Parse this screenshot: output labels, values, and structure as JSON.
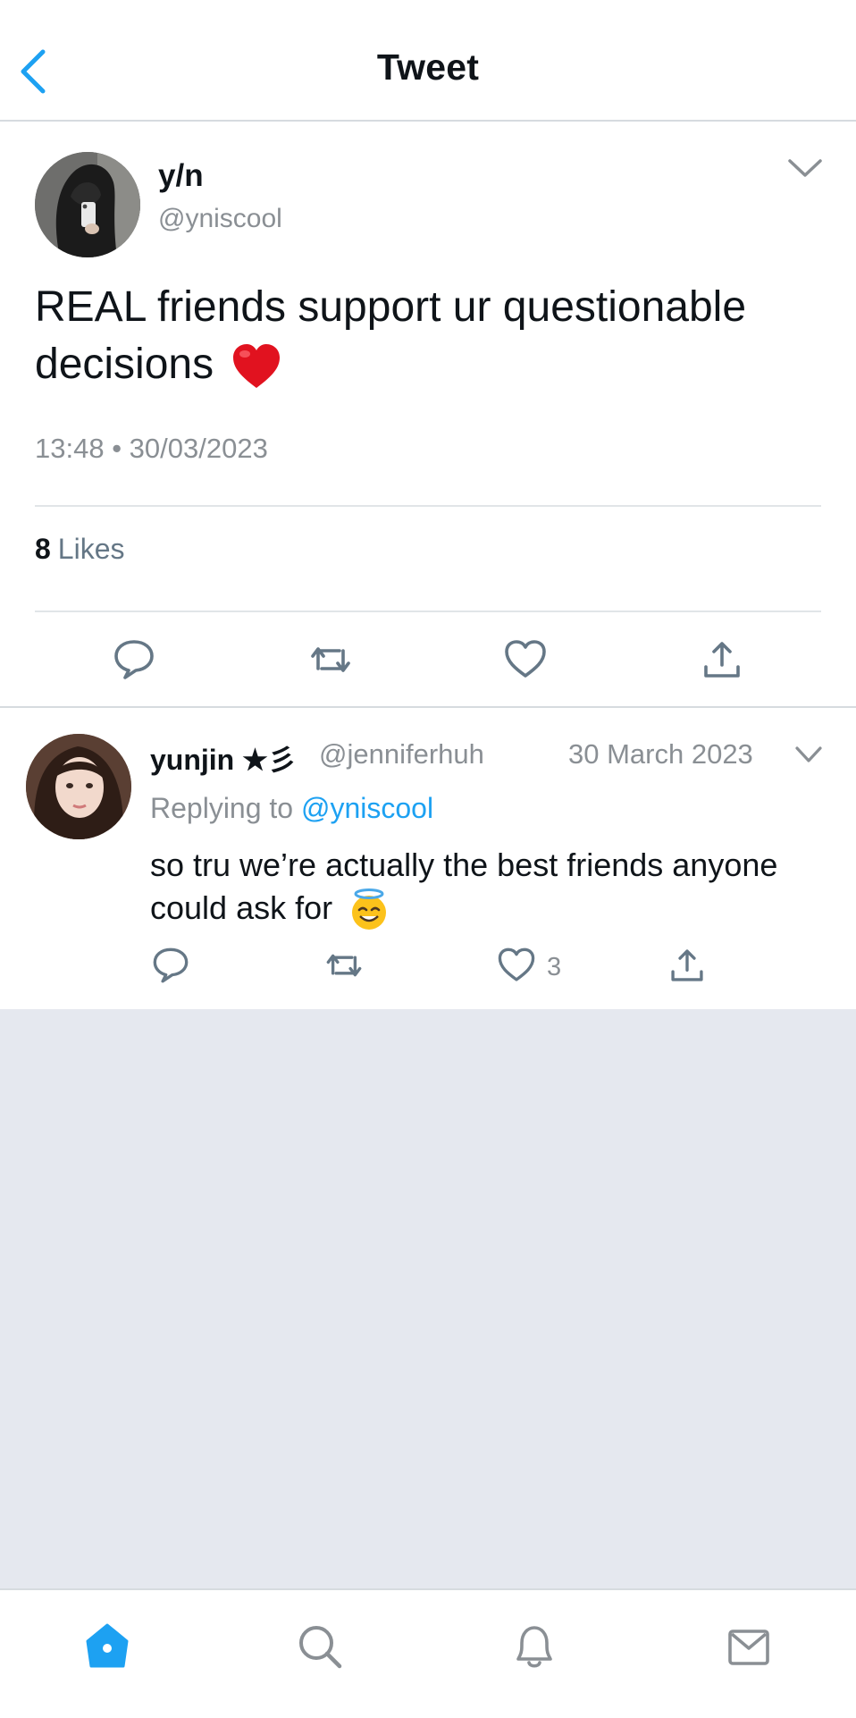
{
  "header": {
    "title": "Tweet"
  },
  "tweet": {
    "author_name": "y/n",
    "author_handle": "@yniscool",
    "text": "REAL friends support ur questionable decisions",
    "emoji": "red-heart",
    "timestamp": "13:48 • 30/03/2023",
    "likes_count": "8",
    "likes_label": "Likes"
  },
  "reply": {
    "author_name": "yunjin ★彡",
    "author_handle": "@jenniferhuh",
    "date": "30 March 2023",
    "replying_prefix": "Replying to",
    "replying_to": "@yniscool",
    "text": "so tru we’re actually the best friends anyone could ask for",
    "emoji": "smiling-face-with-halo",
    "like_count": "3"
  },
  "colors": {
    "accent": "#1da1f2",
    "secondary_text": "#8a8f94",
    "empty_area": "#e5e8ef",
    "icon_gray": "#657786"
  },
  "icons": {
    "header": [
      "back-chevron-icon"
    ],
    "actions": [
      "reply-icon",
      "retweet-icon",
      "like-icon",
      "share-icon"
    ],
    "tabs": [
      "home-icon",
      "search-icon",
      "notifications-icon",
      "messages-icon"
    ]
  }
}
